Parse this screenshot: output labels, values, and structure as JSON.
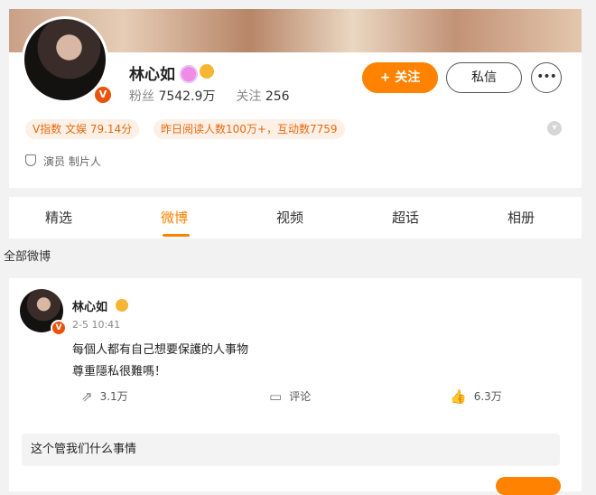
{
  "profile": {
    "name": "林心如",
    "verified_mark": "V",
    "fans_label": "粉丝",
    "fans_value": "7542.9万",
    "follow_label": "关注",
    "follow_value": "256",
    "follow_button": "+ 关注",
    "message_button": "私信",
    "more_button": "•••",
    "chip_index": "V指数 文娱 79.14分",
    "chip_reads": "昨日阅读人数100万+，互动数7759",
    "role": "演员 制片人",
    "colors": {
      "accent": "#ff8200",
      "badge": "#e9530e"
    }
  },
  "tabs": [
    {
      "label": "精选",
      "active": false
    },
    {
      "label": "微博",
      "active": true
    },
    {
      "label": "视频",
      "active": false
    },
    {
      "label": "超话",
      "active": false
    },
    {
      "label": "相册",
      "active": false
    }
  ],
  "feed": {
    "section_label": "全部微博",
    "post": {
      "name": "林心如",
      "time": "2-5 10:41",
      "line1": "每個人都有自己想要保護的人事物",
      "line2": "尊重隱私很難嗎！",
      "repost_count": "3.1万",
      "comment_label": "评论",
      "like_count": "6.3万",
      "icons": {
        "repost": "share-icon",
        "comment": "comment-icon",
        "like": "thumbs-up-icon"
      }
    },
    "comment_input_value": "这个管我们什么事情"
  }
}
